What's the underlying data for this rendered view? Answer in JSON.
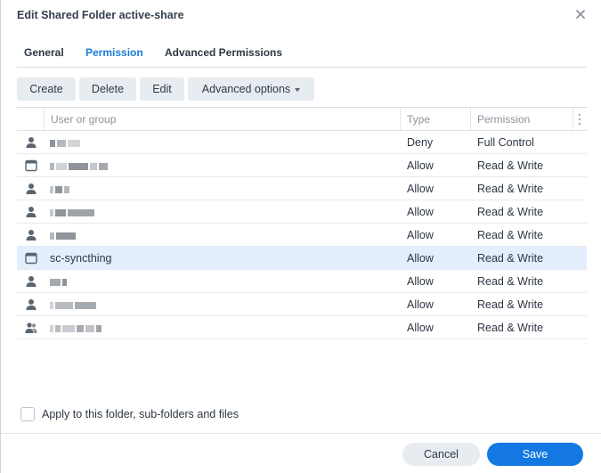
{
  "dialog": {
    "title": "Edit Shared Folder active-share"
  },
  "tabs": [
    {
      "label": "General"
    },
    {
      "label": "Permission"
    },
    {
      "label": "Advanced Permissions"
    }
  ],
  "toolbar": {
    "create_label": "Create",
    "delete_label": "Delete",
    "edit_label": "Edit",
    "advanced_label": "Advanced options"
  },
  "grid": {
    "columns": {
      "user": "User or group",
      "type": "Type",
      "permission": "Permission"
    },
    "rows": [
      {
        "icon": "user-icon",
        "name": "",
        "type": "Deny",
        "permission": "Full Control"
      },
      {
        "icon": "app-window-icon",
        "name": "",
        "type": "Allow",
        "permission": "Read & Write"
      },
      {
        "icon": "user-icon",
        "name": "",
        "type": "Allow",
        "permission": "Read & Write"
      },
      {
        "icon": "user-icon",
        "name": "",
        "type": "Allow",
        "permission": "Read & Write"
      },
      {
        "icon": "user-icon",
        "name": "",
        "type": "Allow",
        "permission": "Read & Write"
      },
      {
        "icon": "app-window-icon",
        "name": "sc-syncthing",
        "type": "Allow",
        "permission": "Read & Write",
        "selected": true
      },
      {
        "icon": "user-icon",
        "name": "",
        "type": "Allow",
        "permission": "Read & Write"
      },
      {
        "icon": "user-icon",
        "name": "",
        "type": "Allow",
        "permission": "Read & Write"
      },
      {
        "icon": "group-icon",
        "name": "",
        "type": "Allow",
        "permission": "Read & Write"
      }
    ]
  },
  "apply": {
    "label": "Apply to this folder, sub-folders and files"
  },
  "footer": {
    "cancel_label": "Cancel",
    "save_label": "Save"
  },
  "colors": {
    "accent": "#1a7bd4",
    "save_button": "#1478e2",
    "selected_row": "#e3effc",
    "button_bg": "#e7ecf1"
  }
}
